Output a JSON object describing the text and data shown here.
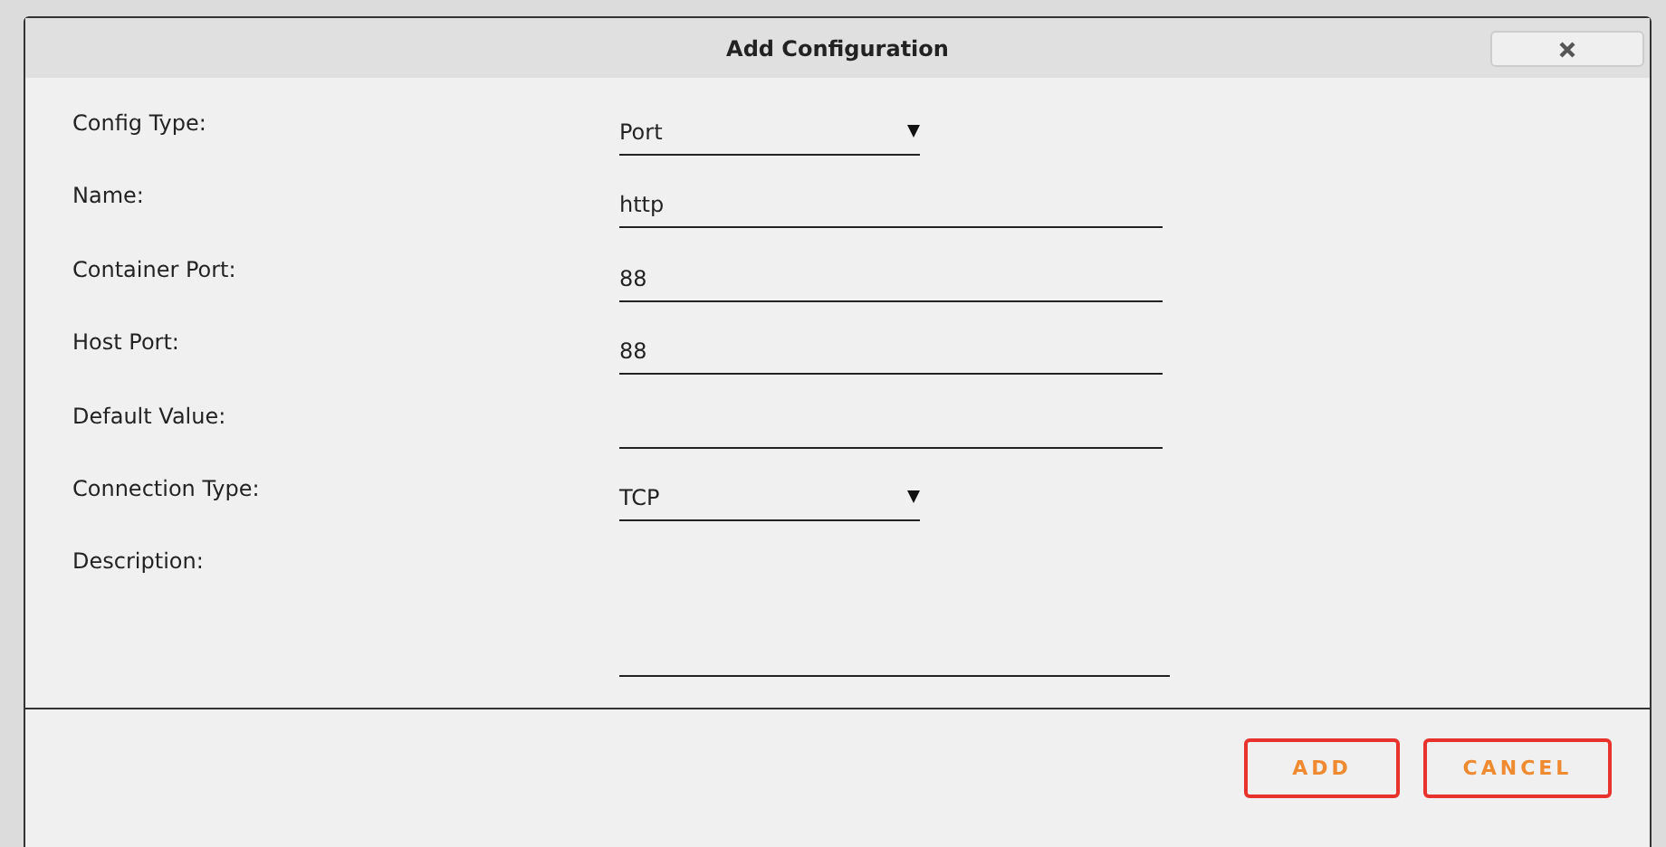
{
  "dialog": {
    "title": "Add Configuration"
  },
  "fields": [
    {
      "label": "Config Type:",
      "kind": "select",
      "value": "Port"
    },
    {
      "label": "Name:",
      "kind": "text",
      "value": "http"
    },
    {
      "label": "Container Port:",
      "kind": "text",
      "value": "88"
    },
    {
      "label": "Host Port:",
      "kind": "text",
      "value": "88"
    },
    {
      "label": "Default Value:",
      "kind": "text"
    },
    {
      "label": "Connection Type:",
      "kind": "select",
      "value": "TCP"
    },
    {
      "label": "Description:",
      "kind": "textarea"
    }
  ],
  "buttons": [
    "ADD",
    "CANCEL"
  ]
}
